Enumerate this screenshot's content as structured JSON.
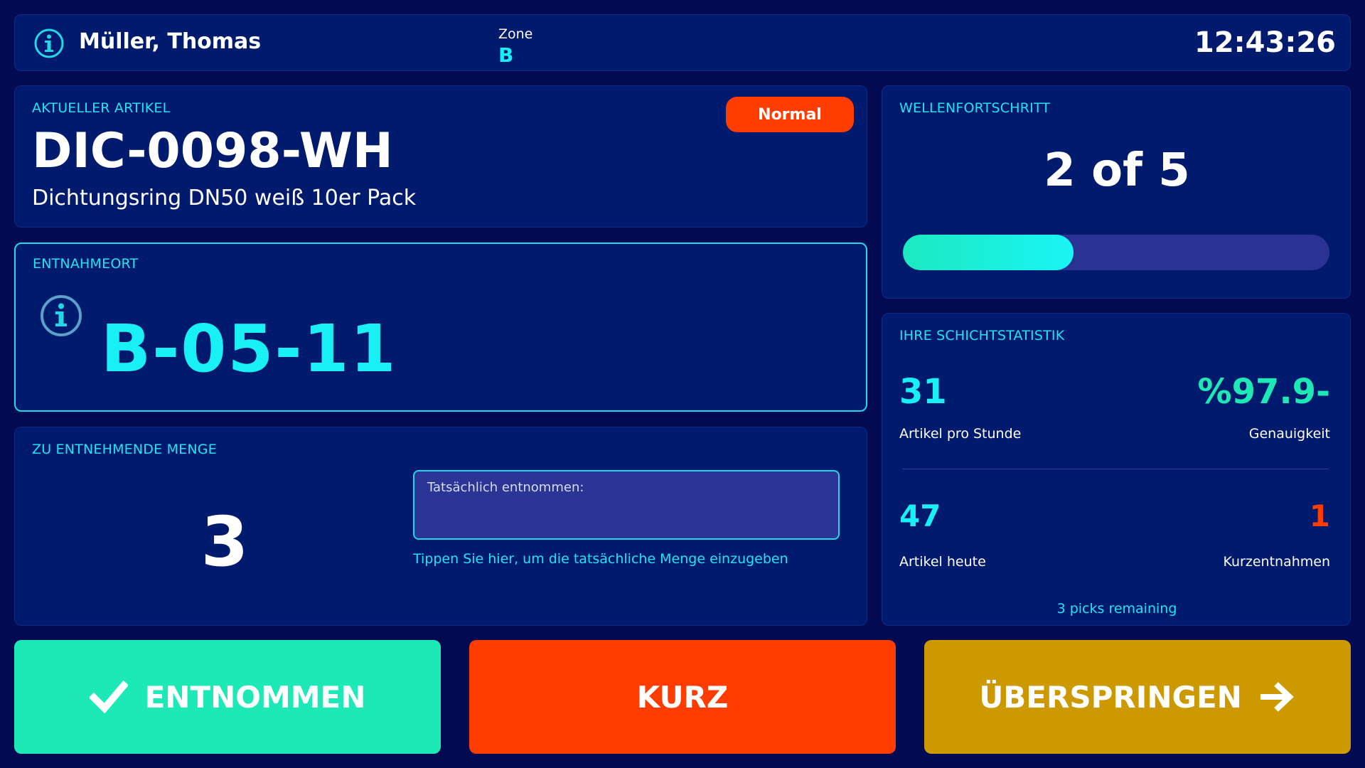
{
  "header": {
    "operator_name": "Müller, Thomas",
    "zone_label": "Zone",
    "zone_value": "B",
    "clock": "12:43:26",
    "icon": "info-icon"
  },
  "article": {
    "section_label": "AKTUELLER ARTIKEL",
    "priority": "Normal",
    "code": "DIC-0098-WH",
    "description": "Dichtungsring DN50 weiß 10er Pack"
  },
  "location": {
    "section_label": "ENTNAHMEORT",
    "code": "B-05-11",
    "icon": "info-icon"
  },
  "quantity": {
    "section_label": "ZU ENTNEHMENDE MENGE",
    "value": "3",
    "input_placeholder": "Tatsächlich entnommen:",
    "input_value": "",
    "hint": "Tippen Sie hier, um die tatsächliche Menge einzugeben"
  },
  "wave": {
    "section_label": "WELLENFORTSCHRITT",
    "progress_text": "2 of 5",
    "progress_fraction": 0.4
  },
  "stats": {
    "section_label": "IHRE SCHICHTSTATISTIK",
    "picks_per_hour_value": "31",
    "picks_per_hour_label": "Artikel pro Stunde",
    "accuracy_value": "%97.9-",
    "accuracy_label": "Genauigkeit",
    "items_today_value": "47",
    "items_today_label": "Artikel heute",
    "short_picks_value": "1",
    "short_picks_label": "Kurzentnahmen",
    "picks_remaining": "3 picks remaining"
  },
  "actions": {
    "picked_label": "ENTNOMMEN",
    "picked_icon": "check-icon",
    "short_label": "KURZ",
    "skip_label": "ÜBERSPRINGEN",
    "skip_icon": "arrow-right-icon"
  },
  "colors": {
    "background": "#020b52",
    "panel": "#001a6e",
    "accent_cyan": "#19f0f5",
    "accent_green": "#1de9b6",
    "alert_orange": "#ff3d00",
    "skip_gold": "#cc9a00",
    "progress_track": "#2a3393"
  }
}
